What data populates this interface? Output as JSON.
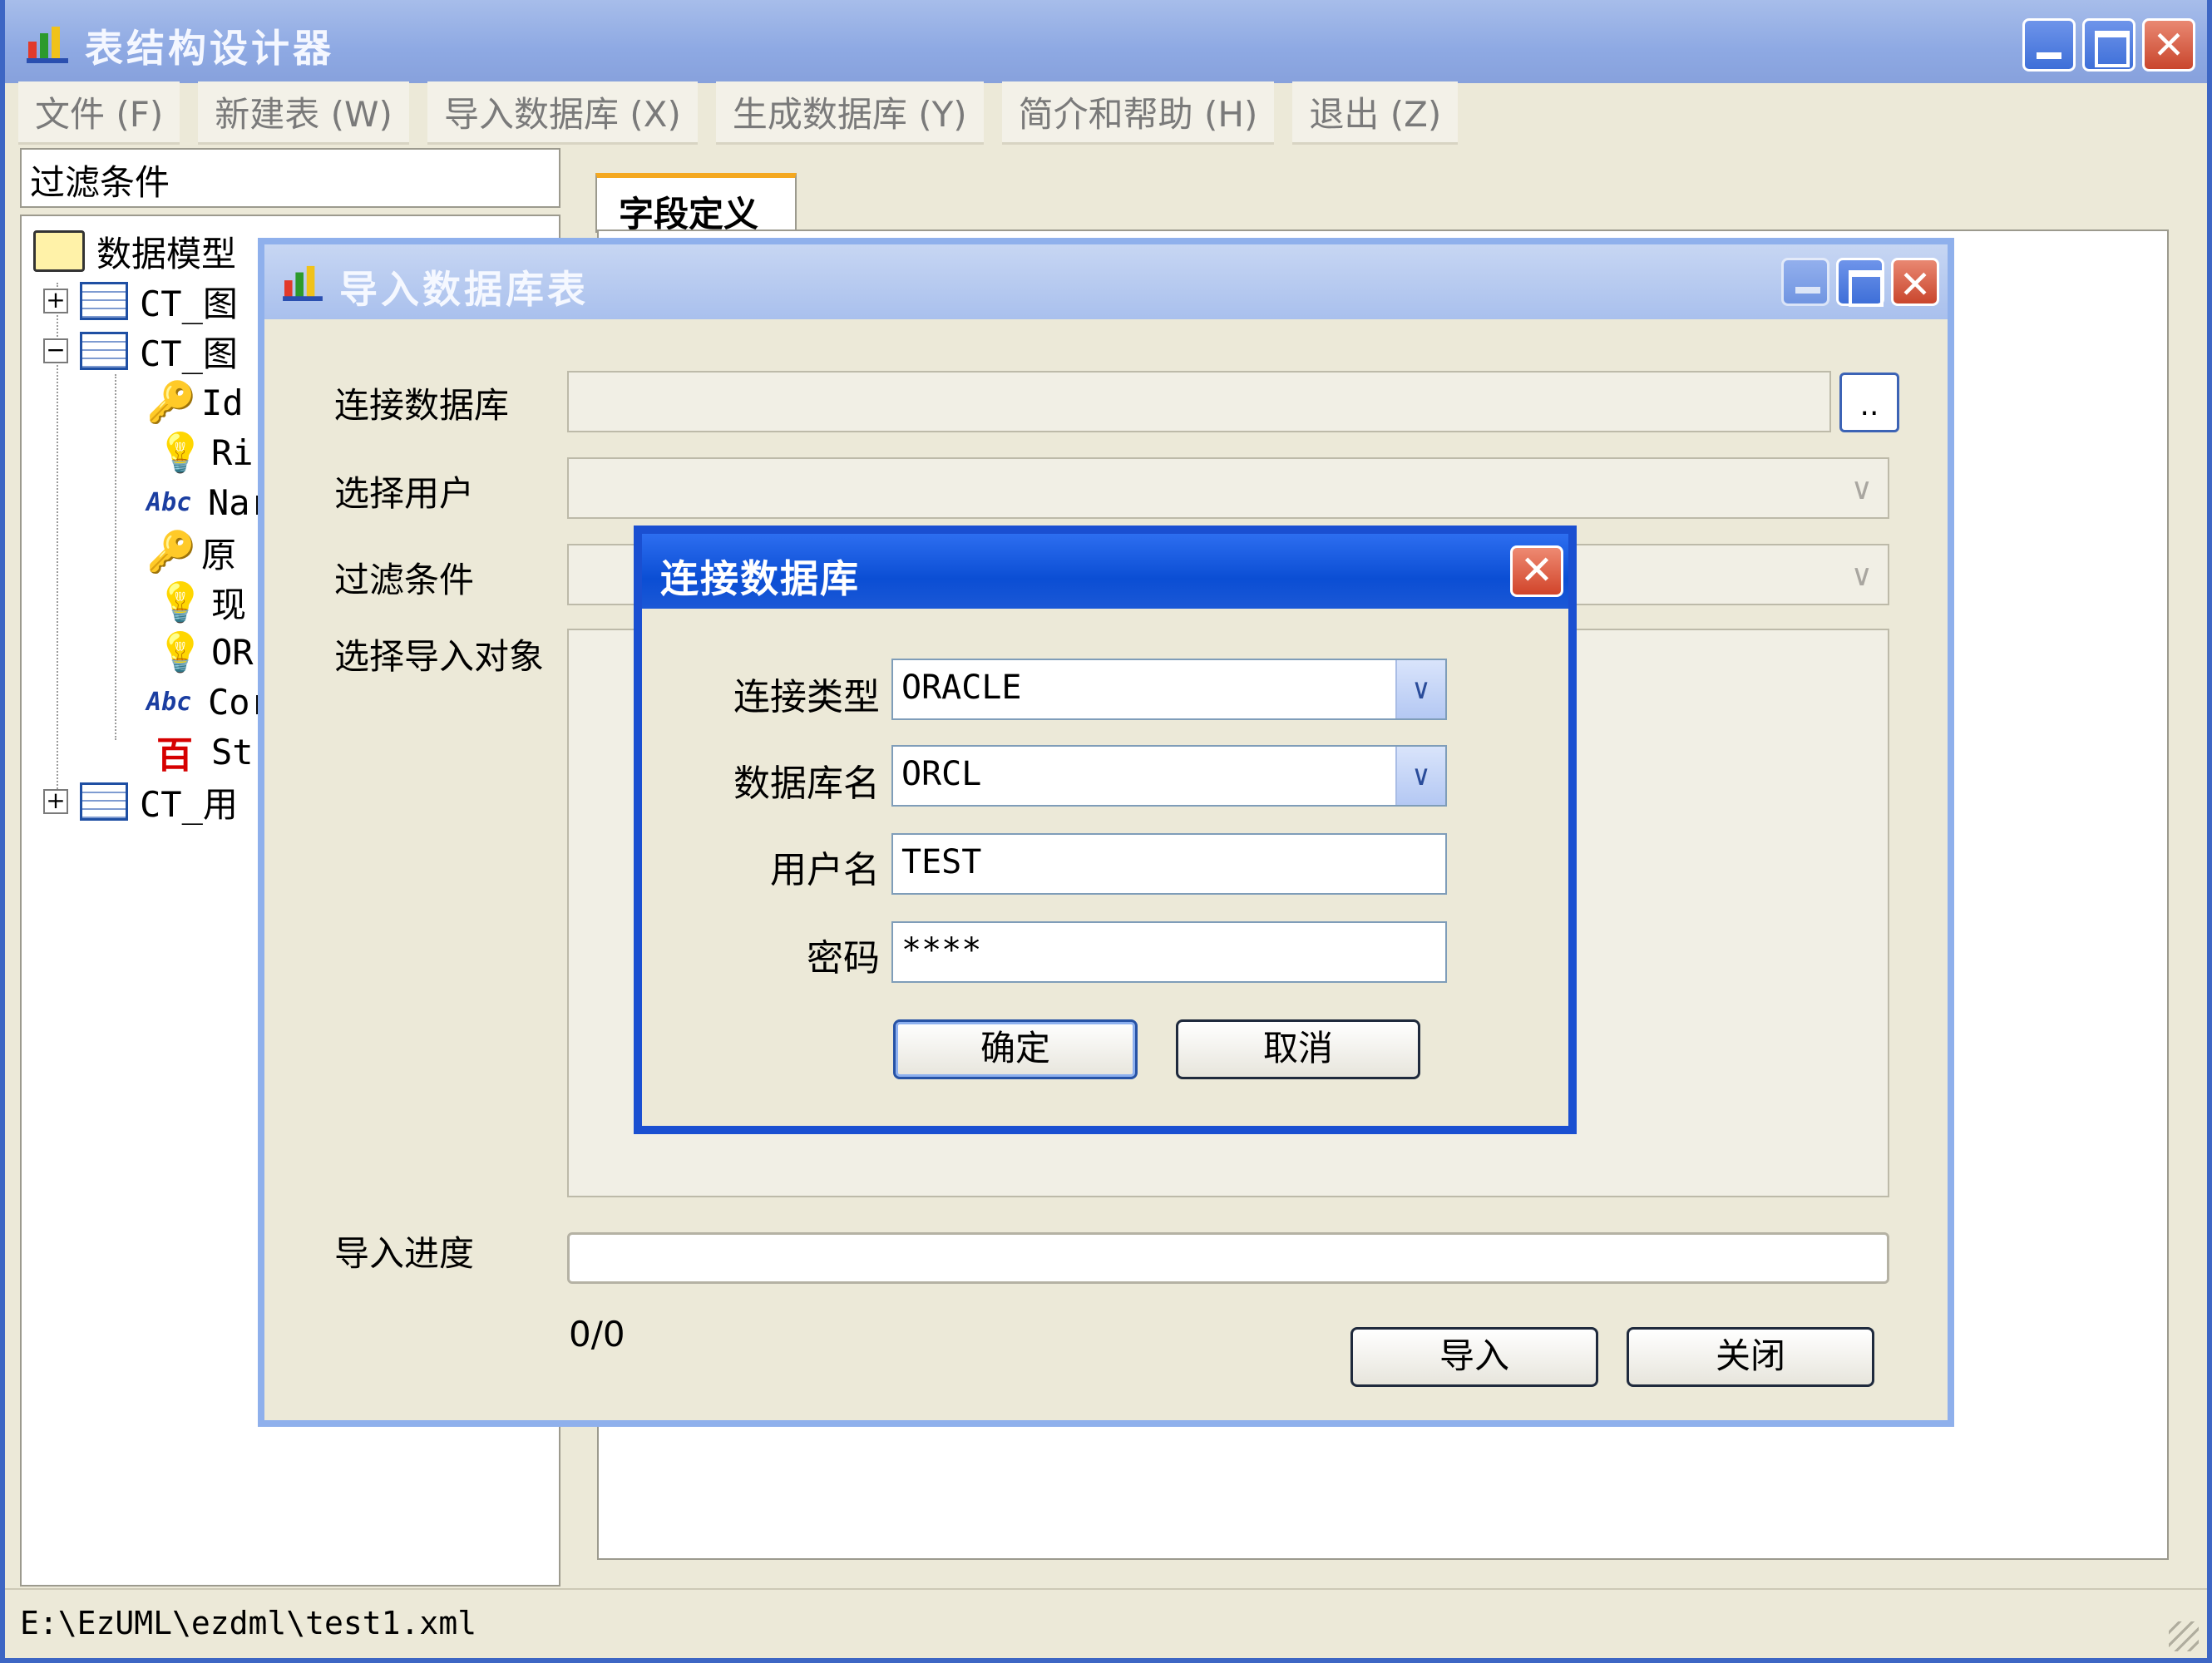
{
  "app": {
    "title": "表结构设计器"
  },
  "menu": [
    "文件 (F)",
    "新建表 (W)",
    "导入数据库 (X)",
    "生成数据库 (Y)",
    "简介和帮助 (H)",
    "退出 (Z)"
  ],
  "left": {
    "filter_label": "过滤条件",
    "tree": {
      "root": "数据模型",
      "nodes": [
        {
          "text": "CT_图",
          "expander": "+"
        },
        {
          "text": "CT_图",
          "expander": "−"
        },
        {
          "text": "Id",
          "icon": "key-icon"
        },
        {
          "text": "Ri",
          "icon": "bulb-icon"
        },
        {
          "text": "Nar",
          "icon": "abc-icon",
          "icon_text": "Abc"
        },
        {
          "text": "原",
          "icon": "key-icon"
        },
        {
          "text": "现",
          "icon": "bulb-icon"
        },
        {
          "text": "OR",
          "icon": "bulb-icon"
        },
        {
          "text": "Cor",
          "icon": "abc-icon",
          "icon_text": "Abc"
        },
        {
          "text": "St",
          "icon": "char-icon",
          "icon_text": "百"
        },
        {
          "text": "CT_用",
          "expander": "+"
        }
      ]
    }
  },
  "tab": {
    "label": "字段定义"
  },
  "status": {
    "path": "E:\\EzUML\\ezdml\\test1.xml"
  },
  "import_dialog": {
    "title": "导入数据库表",
    "labels": {
      "connect": "连接数据库",
      "user": "选择用户",
      "filter": "过滤条件",
      "objects": "选择导入对象",
      "progress": "导入进度"
    },
    "browse_label": "..",
    "dropdown_glyph": "∨",
    "progress_text": "0/0",
    "buttons": {
      "import": "导入",
      "close": "关闭"
    }
  },
  "connect_dialog": {
    "title": "连接数据库",
    "close_glyph": "✕",
    "fields": [
      {
        "label": "连接类型",
        "value": "ORACLE",
        "dropdown": true
      },
      {
        "label": "数据库名",
        "value": "ORCL",
        "dropdown": true
      },
      {
        "label": "用户名",
        "value": "TEST",
        "dropdown": false
      },
      {
        "label": "密码",
        "value": "****",
        "dropdown": false
      }
    ],
    "dropdown_glyph": "∨",
    "buttons": {
      "ok": "确定",
      "cancel": "取消"
    }
  },
  "colors": {
    "titlebar": "#8ea9e3",
    "active_title": "#0b4ed4",
    "window_bg": "#ece9d8",
    "tab_accent": "#f4a820"
  }
}
